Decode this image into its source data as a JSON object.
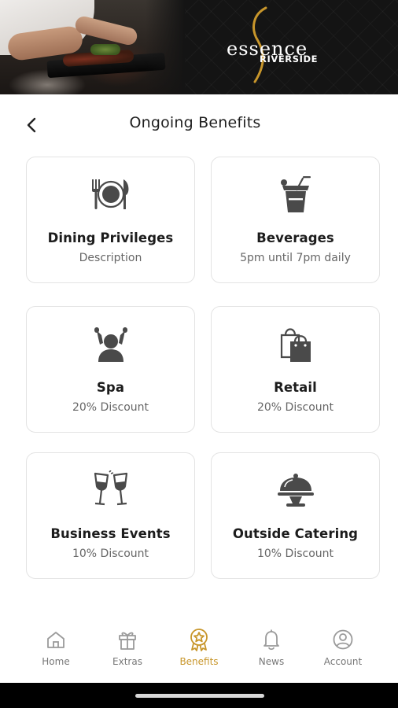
{
  "brand": {
    "logo_word": "essence",
    "logo_sub": "RIVERSIDE",
    "accent_color": "#c8962b"
  },
  "header": {
    "title": "Ongoing Benefits",
    "back_icon": "chevron-left-icon"
  },
  "benefits": [
    {
      "title": "Dining Privileges",
      "subtitle": "Description",
      "icon": "plate-cutlery-icon"
    },
    {
      "title": "Beverages",
      "subtitle": "5pm until 7pm daily",
      "icon": "cocktail-glass-icon"
    },
    {
      "title": "Spa",
      "subtitle": "20% Discount",
      "icon": "spa-person-icon"
    },
    {
      "title": "Retail",
      "subtitle": "20% Discount",
      "icon": "shopping-bags-icon"
    },
    {
      "title": "Business Events",
      "subtitle": "10% Discount",
      "icon": "wine-glasses-icon"
    },
    {
      "title": "Outside Catering",
      "subtitle": "10% Discount",
      "icon": "cloche-tray-icon"
    }
  ],
  "nav": {
    "items": [
      {
        "label": "Home",
        "icon": "home-icon"
      },
      {
        "label": "Extras",
        "icon": "gift-icon"
      },
      {
        "label": "Benefits",
        "icon": "award-badge-icon",
        "active": true
      },
      {
        "label": "News",
        "icon": "bell-icon"
      },
      {
        "label": "Account",
        "icon": "account-icon"
      }
    ]
  }
}
